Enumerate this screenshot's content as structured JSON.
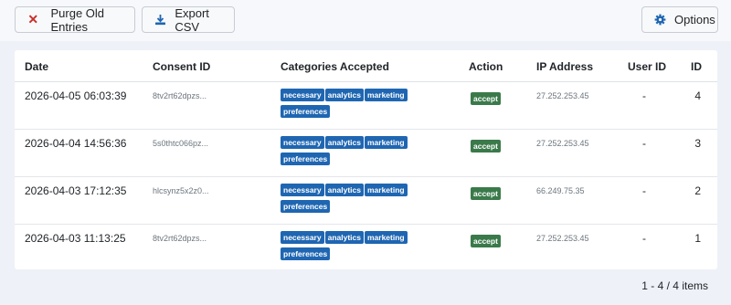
{
  "toolbar": {
    "purge_label": "Purge Old Entries",
    "export_label": "Export CSV",
    "options_label": "Options",
    "colors": {
      "purge_icon": "#c9302c",
      "export_icon": "#1f66b2",
      "options_icon": "#1f66b2"
    }
  },
  "table": {
    "columns": [
      "Date",
      "Consent ID",
      "Categories Accepted",
      "Action",
      "IP Address",
      "User ID",
      "ID"
    ],
    "rows": [
      {
        "date": "2026-04-05 06:03:39",
        "consent_id": "8tv2rt62dpzs...",
        "categories": [
          "necessary",
          "analytics",
          "marketing",
          "preferences"
        ],
        "action": "accept",
        "ip": "27.252.253.45",
        "user_id": "-",
        "id": "4"
      },
      {
        "date": "2026-04-04 14:56:36",
        "consent_id": "5s0thtc066pz...",
        "categories": [
          "necessary",
          "analytics",
          "marketing",
          "preferences"
        ],
        "action": "accept",
        "ip": "27.252.253.45",
        "user_id": "-",
        "id": "3"
      },
      {
        "date": "2026-04-03 17:12:35",
        "consent_id": "hlcsynz5x2z0...",
        "categories": [
          "necessary",
          "analytics",
          "marketing",
          "preferences"
        ],
        "action": "accept",
        "ip": "66.249.75.35",
        "user_id": "-",
        "id": "2"
      },
      {
        "date": "2026-04-03 11:13:25",
        "consent_id": "8tv2rt62dpzs...",
        "categories": [
          "necessary",
          "analytics",
          "marketing",
          "preferences"
        ],
        "action": "accept",
        "ip": "27.252.253.45",
        "user_id": "-",
        "id": "1"
      }
    ]
  },
  "pagination": {
    "summary": "1 - 4 / 4 items"
  },
  "colors": {
    "category_badge": "#1f66b2",
    "action_badge": "#3a7a4a"
  }
}
